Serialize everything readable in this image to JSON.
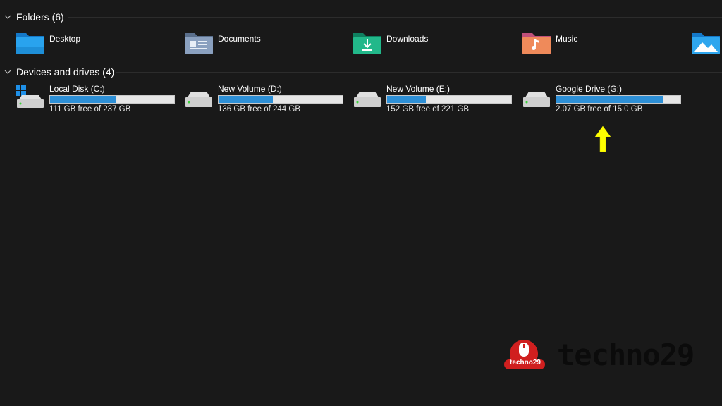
{
  "sections": {
    "folders": {
      "title": "Folders (6)"
    },
    "drives": {
      "title": "Devices and drives (4)"
    }
  },
  "folders": [
    {
      "label": "Desktop",
      "icon": "desktop-folder-icon",
      "color": "#1e90d8"
    },
    {
      "label": "Documents",
      "icon": "documents-folder-icon",
      "color": "#6f86a6"
    },
    {
      "label": "Downloads",
      "icon": "downloads-folder-icon",
      "color": "#1aa37a"
    },
    {
      "label": "Music",
      "icon": "music-folder-icon",
      "color": "#e5734f"
    },
    {
      "label": "",
      "icon": "pictures-folder-icon",
      "color": "#1e90d8"
    }
  ],
  "drives": [
    {
      "name": "Local Disk (C:)",
      "free": "111 GB free of 237 GB",
      "used_fraction": 0.53,
      "icon": "windows-drive-icon"
    },
    {
      "name": "New Volume (D:)",
      "free": "136 GB free of 244 GB",
      "used_fraction": 0.44,
      "icon": "hard-drive-icon"
    },
    {
      "name": "New Volume (E:)",
      "free": "152 GB free of 221 GB",
      "used_fraction": 0.31,
      "icon": "hard-drive-icon"
    },
    {
      "name": "Google Drive (G:)",
      "free": "2.07 GB free of 15.0 GB",
      "used_fraction": 0.86,
      "icon": "hard-drive-icon"
    }
  ],
  "annotation": {
    "icon": "yellow-arrow-up-icon",
    "color": "#ffff00"
  },
  "watermark": {
    "badge": "techno29",
    "text": "techno29",
    "color": "#d01f1f"
  },
  "colors": {
    "background": "#191919",
    "bar_fill": "#2d8fd6",
    "bar_track": "#e6e6e6"
  }
}
